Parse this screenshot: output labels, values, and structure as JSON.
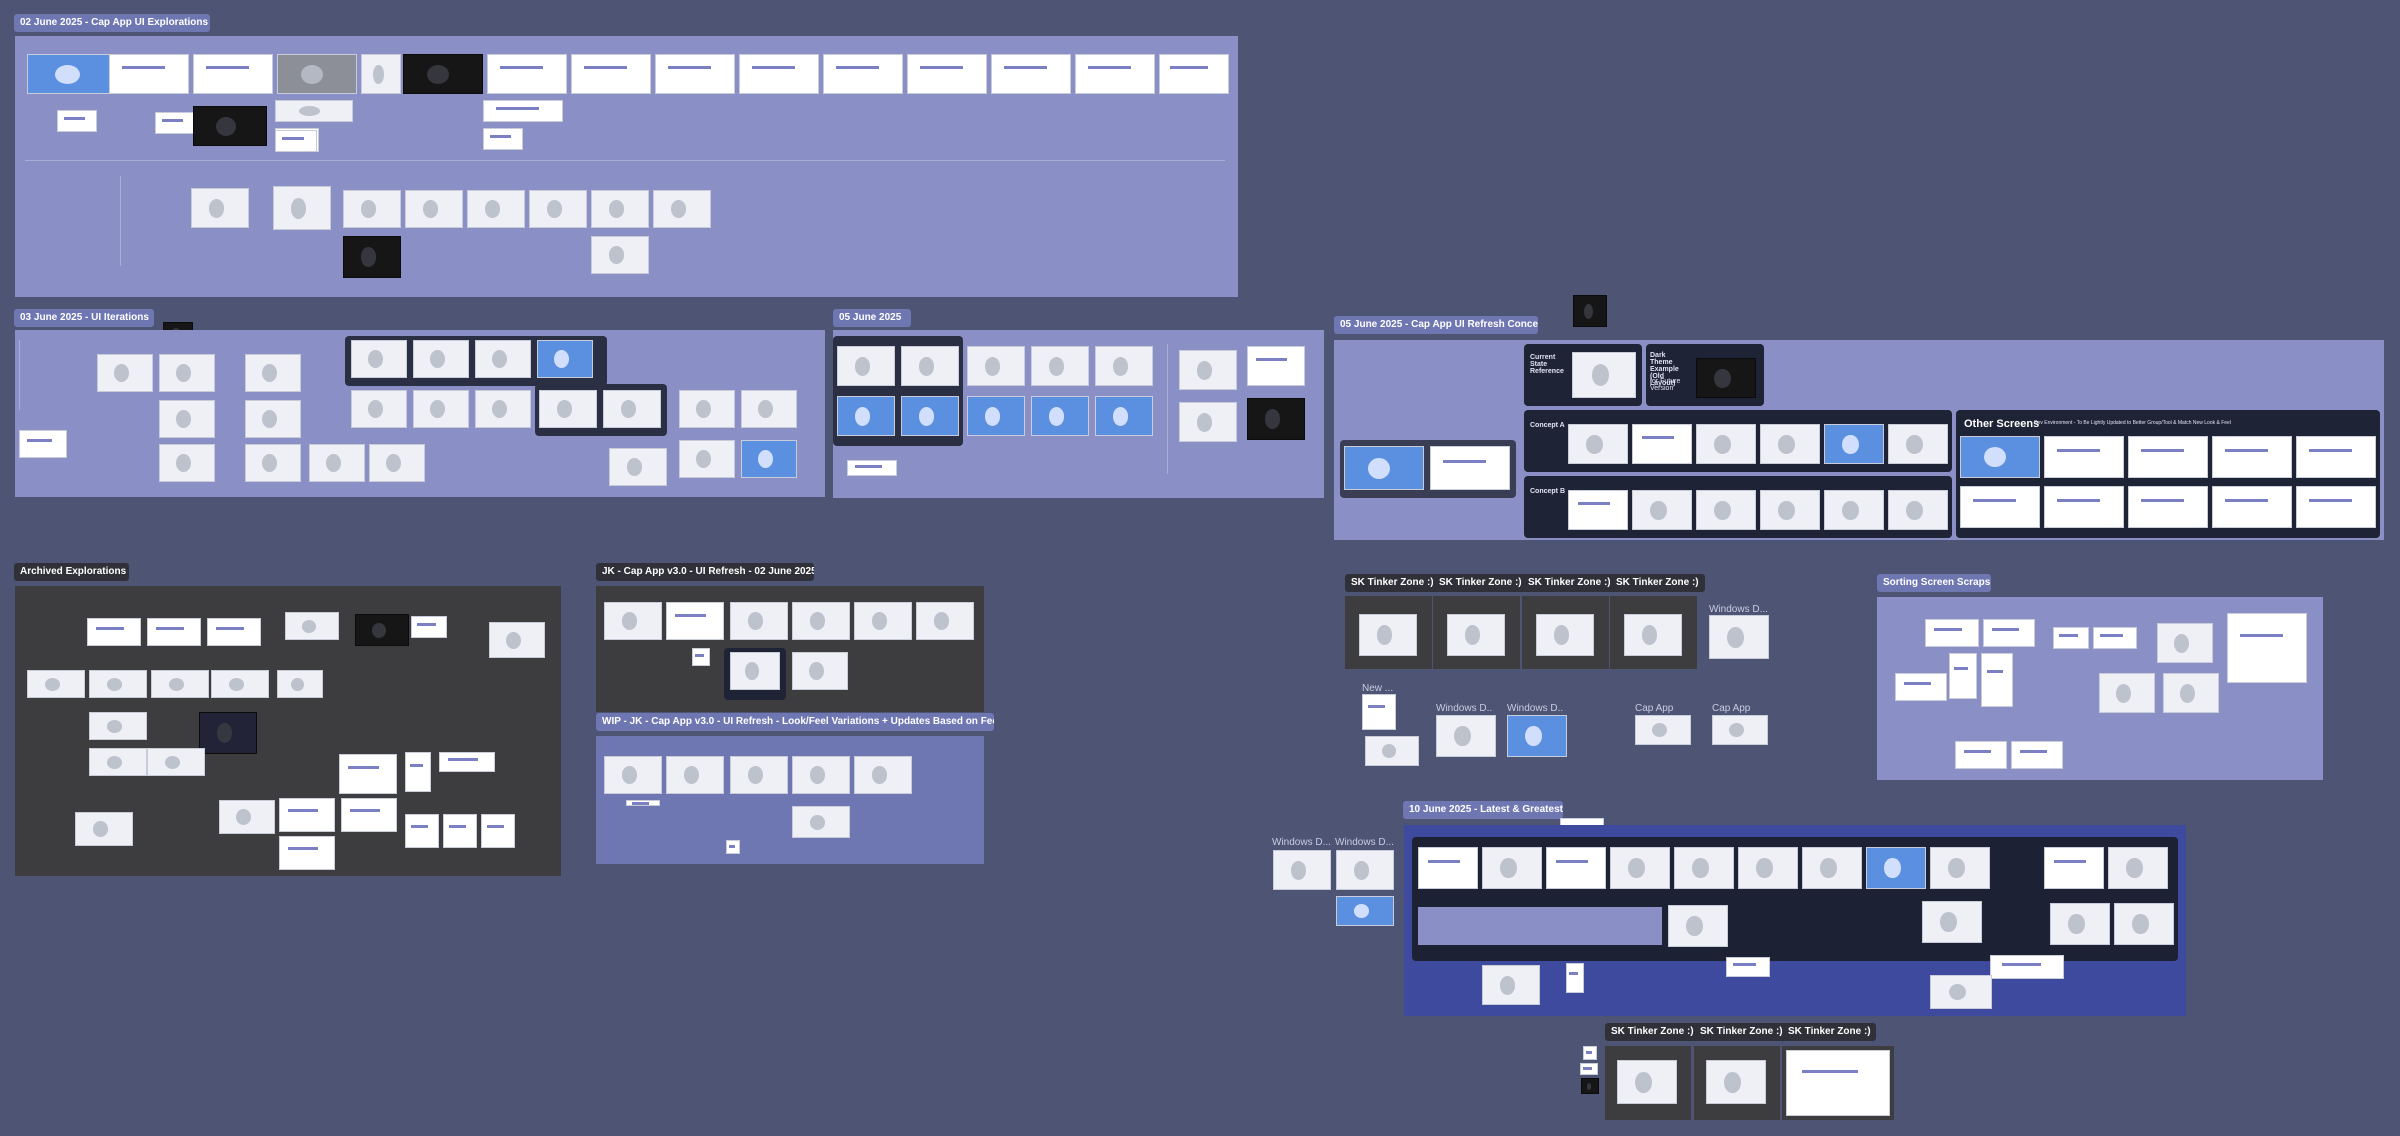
{
  "sections": {
    "s02": {
      "title": "02 June 2025 - Cap App UI Explorations"
    },
    "s03": {
      "title": "03 June 2025 - UI Iterations"
    },
    "s0605": {
      "title": "05 June 2025"
    },
    "s05concepts": {
      "title": "05 June 2025 - Cap App UI Refresh Concepts"
    },
    "archived": {
      "title": "Archived Explorations"
    },
    "jk": {
      "title": "JK - Cap App v3.0 - UI Refresh - 02 June 2025"
    },
    "wip": {
      "title": "WIP - JK - Cap App v3.0 - UI Refresh - Look/Feel Variations + Updates Based on Feedb..."
    },
    "sorting": {
      "title": "Sorting Screen Scraps"
    },
    "latest": {
      "title": "10 June 2025 - Latest & Greatest"
    }
  },
  "concepts": {
    "current_state": "Current State Reference",
    "dark_theme": "Dark Theme Example (Old Layout)",
    "future": "for Future Version",
    "concept_a": "Concept A",
    "concept_b": "Concept B",
    "other_screens": "Other Screens",
    "other_note": "Dev Environment - To Be Lightly Updated to Better Group/Tool & Match New Look & Feel"
  },
  "tinker": {
    "labels": [
      "SK Tinker Zone :)",
      "SK Tinker Zone :)",
      "SK Tinker Zone :)",
      "SK Tinker Zone :)"
    ],
    "bottom_labels": [
      "SK Tinker Zone :)",
      "SK Tinker Zone :)",
      "SK Tinker Zone :)"
    ],
    "windows_d": "Windows D...",
    "new": "New ...",
    "cap_app": "Cap App"
  },
  "colors": {
    "canvas": "#4d5474",
    "section_blue": "#8a90c6",
    "section_dark": "#3d3d40",
    "latest_blue": "#3d4a9e",
    "label_blue": "#6f77b3",
    "label_dark": "#2f3038"
  }
}
